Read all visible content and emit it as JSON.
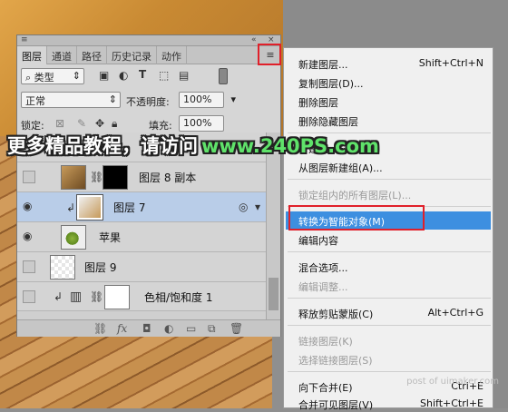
{
  "panel": {
    "grip": "≡",
    "collapse": "«",
    "close": "×",
    "tabs": [
      "图层",
      "通道",
      "路径",
      "历史记录",
      "动作"
    ],
    "menu_icon": "≡",
    "filter_kind": "类型",
    "blend_mode": "正常",
    "opacity_label": "不透明度:",
    "opacity_value": "100%",
    "lock_label": "锁定:",
    "fill_label": "填充:",
    "fill_value": "100%",
    "layers": [
      {
        "name": "",
        "visible": false
      },
      {
        "name": "图层 8 副本",
        "visible": false
      },
      {
        "name": "图层 7",
        "visible": true,
        "active": true
      },
      {
        "name": "苹果",
        "visible": true
      },
      {
        "name": "图层 9",
        "visible": false
      },
      {
        "name": "色相/饱和度 1",
        "visible": false
      }
    ]
  },
  "menu": {
    "items": [
      {
        "label": "新建图层...",
        "shortcut": "Shift+Ctrl+N",
        "disabled": false
      },
      {
        "label": "复制图层(D)...",
        "shortcut": "",
        "disabled": false
      },
      {
        "label": "删除图层",
        "shortcut": "",
        "disabled": false
      },
      {
        "label": "删除隐藏图层",
        "shortcut": "",
        "disabled": false
      },
      {
        "label": "新建组...",
        "shortcut": "",
        "disabled": false
      },
      {
        "label": "从图层新建组(A)...",
        "shortcut": "",
        "disabled": false
      },
      {
        "label": "锁定组内的所有图层(L)...",
        "shortcut": "",
        "disabled": true
      },
      {
        "label": "转换为智能对象(M)",
        "shortcut": "",
        "disabled": false,
        "highlighted": true
      },
      {
        "label": "编辑内容",
        "shortcut": "",
        "disabled": false
      },
      {
        "label": "混合选项...",
        "shortcut": "",
        "disabled": false
      },
      {
        "label": "编辑调整...",
        "shortcut": "",
        "disabled": true
      },
      {
        "label": "释放剪贴蒙版(C)",
        "shortcut": "Alt+Ctrl+G",
        "disabled": false
      },
      {
        "label": "链接图层(K)",
        "shortcut": "",
        "disabled": true
      },
      {
        "label": "选择链接图层(S)",
        "shortcut": "",
        "disabled": true
      },
      {
        "label": "向下合并(E)",
        "shortcut": "Ctrl+E",
        "disabled": false
      },
      {
        "label": "合并可见图层(V)",
        "shortcut": "Shift+Ctrl+E",
        "disabled": false
      }
    ]
  },
  "watermark": {
    "text": "更多精品教程，请访问",
    "url": "www.240PS.com"
  },
  "footer": "post of uimaker.com",
  "colors": {
    "highlight": "#3d8fe0",
    "red_box": "#e0202a",
    "watermark_url": "#5fe26a"
  }
}
